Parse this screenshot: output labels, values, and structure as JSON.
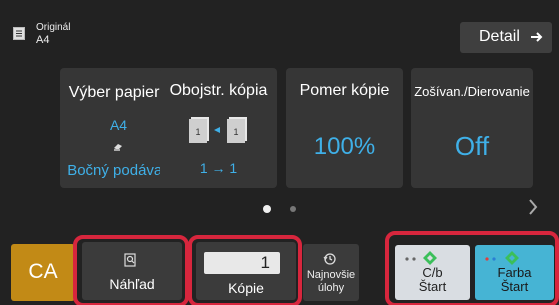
{
  "header": {
    "original_title": "Originál",
    "original_size": "A4",
    "detail_label": "Detail"
  },
  "tiles": {
    "paper": {
      "title": "Výber papiera",
      "size": "A4",
      "source": "Bočný podávač"
    },
    "duplex": {
      "title": "Obojstr. kópia",
      "value": "1 → 1"
    },
    "ratio": {
      "title": "Pomer kópie",
      "value": "100%"
    },
    "staple": {
      "title": "Zošívan./Dierovanie",
      "value": "Off"
    }
  },
  "pagination": {
    "current_page": 1,
    "total_pages": 2
  },
  "bottom_bar": {
    "ca_label": "CA",
    "preview_label": "Náhľad",
    "copies_value": "1",
    "copies_label": "Kópie",
    "recent_label": "Najnovšie úlohy",
    "bw_label_line1": "C/b",
    "bw_label_line2": "Štart",
    "color_label_line1": "Farba",
    "color_label_line2": "Štart"
  },
  "colors": {
    "accent_blue": "#3fb0e8",
    "ca_orange": "#c28a16",
    "color_start": "#46b4d4",
    "bw_start": "#d9dde2",
    "annotation_red": "#d7263d",
    "start_green": "#3bbf5a"
  },
  "icons": {
    "original": "document-icon",
    "detail": "arrow-right-icon",
    "duplex": "duplex-pages-icon",
    "paper_source": "bypass-tray-icon",
    "next_page": "chevron-right-icon",
    "preview": "magnifier-document-icon",
    "recent": "history-clock-icon",
    "start": "diamond-start-icon"
  }
}
